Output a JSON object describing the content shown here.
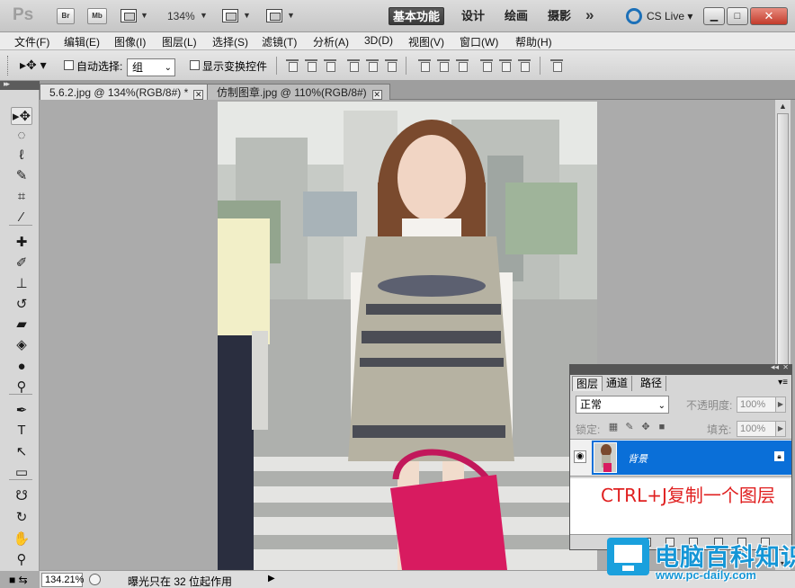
{
  "titlebar": {
    "app_logo": "Ps",
    "bridge_btn": "Br",
    "minibridge_btn": "Mb",
    "zoom": "134%",
    "workspaces": [
      "基本功能",
      "设计",
      "绘画",
      "摄影"
    ],
    "more_symbol": "»",
    "cslive": "CS Live",
    "window_buttons": [
      "▁",
      "□",
      "✕"
    ]
  },
  "menu": [
    "文件(F)",
    "编辑(E)",
    "图像(I)",
    "图层(L)",
    "选择(S)",
    "滤镜(T)",
    "分析(A)",
    "3D(D)",
    "视图(V)",
    "窗口(W)",
    "帮助(H)"
  ],
  "options": {
    "auto_select_label": "自动选择:",
    "auto_select_value": "组",
    "show_transform_label": "显示变换控件"
  },
  "tabs": [
    {
      "label": "5.6.2.jpg @ 134%(RGB/8#) *",
      "active": true
    },
    {
      "label": "仿制图章.jpg @ 110%(RGB/8#)",
      "active": false
    }
  ],
  "tools": [
    {
      "name": "move-tool-icon",
      "glyph": "▸✥"
    },
    {
      "name": "marquee-tool-icon",
      "glyph": "◌"
    },
    {
      "name": "lasso-tool-icon",
      "glyph": "ℓ"
    },
    {
      "name": "quick-select-tool-icon",
      "glyph": "✎"
    },
    {
      "name": "crop-tool-icon",
      "glyph": "⌗"
    },
    {
      "name": "eyedropper-tool-icon",
      "glyph": "⁄"
    },
    {
      "name": "healing-brush-tool-icon",
      "glyph": "✚"
    },
    {
      "name": "brush-tool-icon",
      "glyph": "✐"
    },
    {
      "name": "clone-stamp-tool-icon",
      "glyph": "⊥"
    },
    {
      "name": "history-brush-tool-icon",
      "glyph": "↺"
    },
    {
      "name": "eraser-tool-icon",
      "glyph": "▰"
    },
    {
      "name": "paint-bucket-tool-icon",
      "glyph": "◈"
    },
    {
      "name": "blur-tool-icon",
      "glyph": "●"
    },
    {
      "name": "dodge-tool-icon",
      "glyph": "⚲"
    },
    {
      "name": "pen-tool-icon",
      "glyph": "✒"
    },
    {
      "name": "type-tool-icon",
      "glyph": "T"
    },
    {
      "name": "path-select-tool-icon",
      "glyph": "↖"
    },
    {
      "name": "rectangle-tool-icon",
      "glyph": "▭"
    },
    {
      "name": "3d-rotate-tool-icon",
      "glyph": "☋"
    },
    {
      "name": "3d-orbit-tool-icon",
      "glyph": "↻"
    },
    {
      "name": "hand-tool-icon",
      "glyph": "✋"
    },
    {
      "name": "zoom-tool-icon",
      "glyph": "⚲"
    }
  ],
  "statusbar": {
    "zoom": "134.21%",
    "message": "曝光只在 32 位起作用"
  },
  "layers_panel": {
    "tabs": [
      "图层",
      "通道",
      "路径"
    ],
    "blend_mode": "正常",
    "opacity_label": "不透明度:",
    "opacity_value": "100%",
    "lock_label": "锁定:",
    "fill_label": "填充:",
    "fill_value": "100%",
    "layer_name": "背景",
    "annotation": "CTRL+J复制一个图层"
  },
  "watermark": {
    "title": "电脑百科知识",
    "url": "www.pc-daily.com"
  },
  "colors": {
    "accent_blue": "#0a6fd8",
    "annotation_red": "#e02020",
    "watermark_blue": "#1596d6"
  }
}
